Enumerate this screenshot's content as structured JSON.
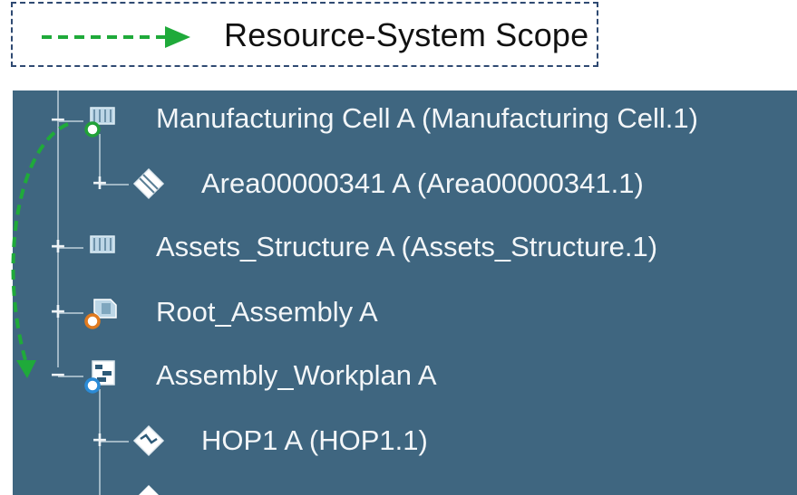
{
  "legend": {
    "label": "Resource-System Scope",
    "arrow_color": "#1faa3a",
    "border_color": "#2f4a72"
  },
  "tree": {
    "background": "#3f6680",
    "items": [
      {
        "label": "Manufacturing Cell A (Manufacturing Cell.1)",
        "expander": "−",
        "icon": "manufacturing-cell-icon"
      },
      {
        "label": "Area00000341 A (Area00000341.1)",
        "expander": "+",
        "icon": "area-icon"
      },
      {
        "label": "Assets_Structure A (Assets_Structure.1)",
        "expander": "+",
        "icon": "assets-structure-icon"
      },
      {
        "label": "Root_Assembly A",
        "expander": "+",
        "icon": "root-assembly-icon"
      },
      {
        "label": "Assembly_Workplan A",
        "expander": "−",
        "icon": "workplan-icon"
      },
      {
        "label": "HOP1 A (HOP1.1)",
        "expander": "+",
        "icon": "hop-icon"
      }
    ]
  }
}
